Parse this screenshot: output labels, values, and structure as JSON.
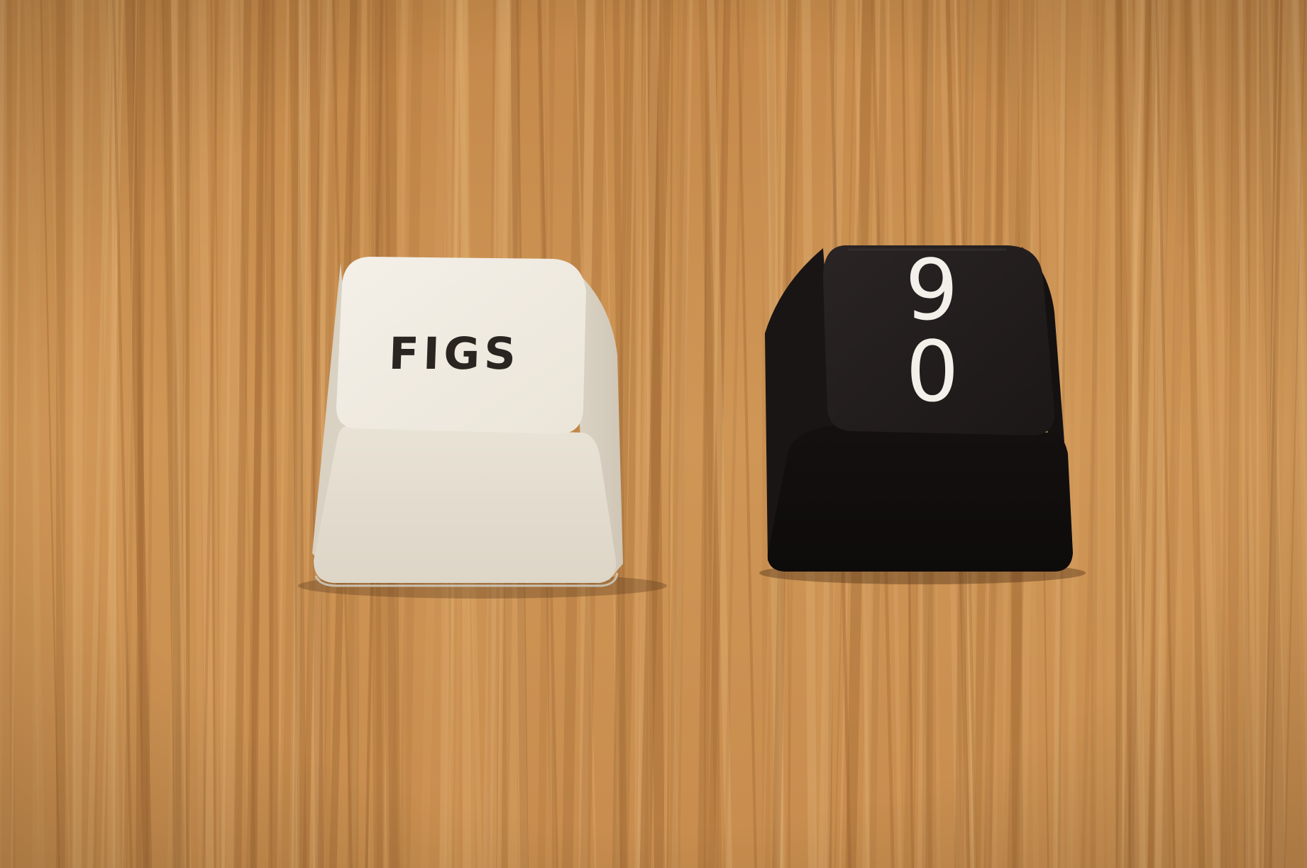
{
  "scene": {
    "surface": "bamboo-wood-board",
    "colors": {
      "wood_base": "#c98f4f",
      "wood_light": "#dfae72",
      "wood_dark": "#9b6330",
      "white_cap": "#ece6da",
      "white_cap_top": "#f1ece3",
      "black_cap": "#181414",
      "black_cap_top": "#221d1d"
    }
  },
  "keycaps": [
    {
      "color_name": "white",
      "legend": "FIGS",
      "legend_color": "#2a2520"
    },
    {
      "color_name": "black",
      "legend_top": "9",
      "legend_bottom": "0",
      "legend_color": "#f3f0ea"
    }
  ]
}
